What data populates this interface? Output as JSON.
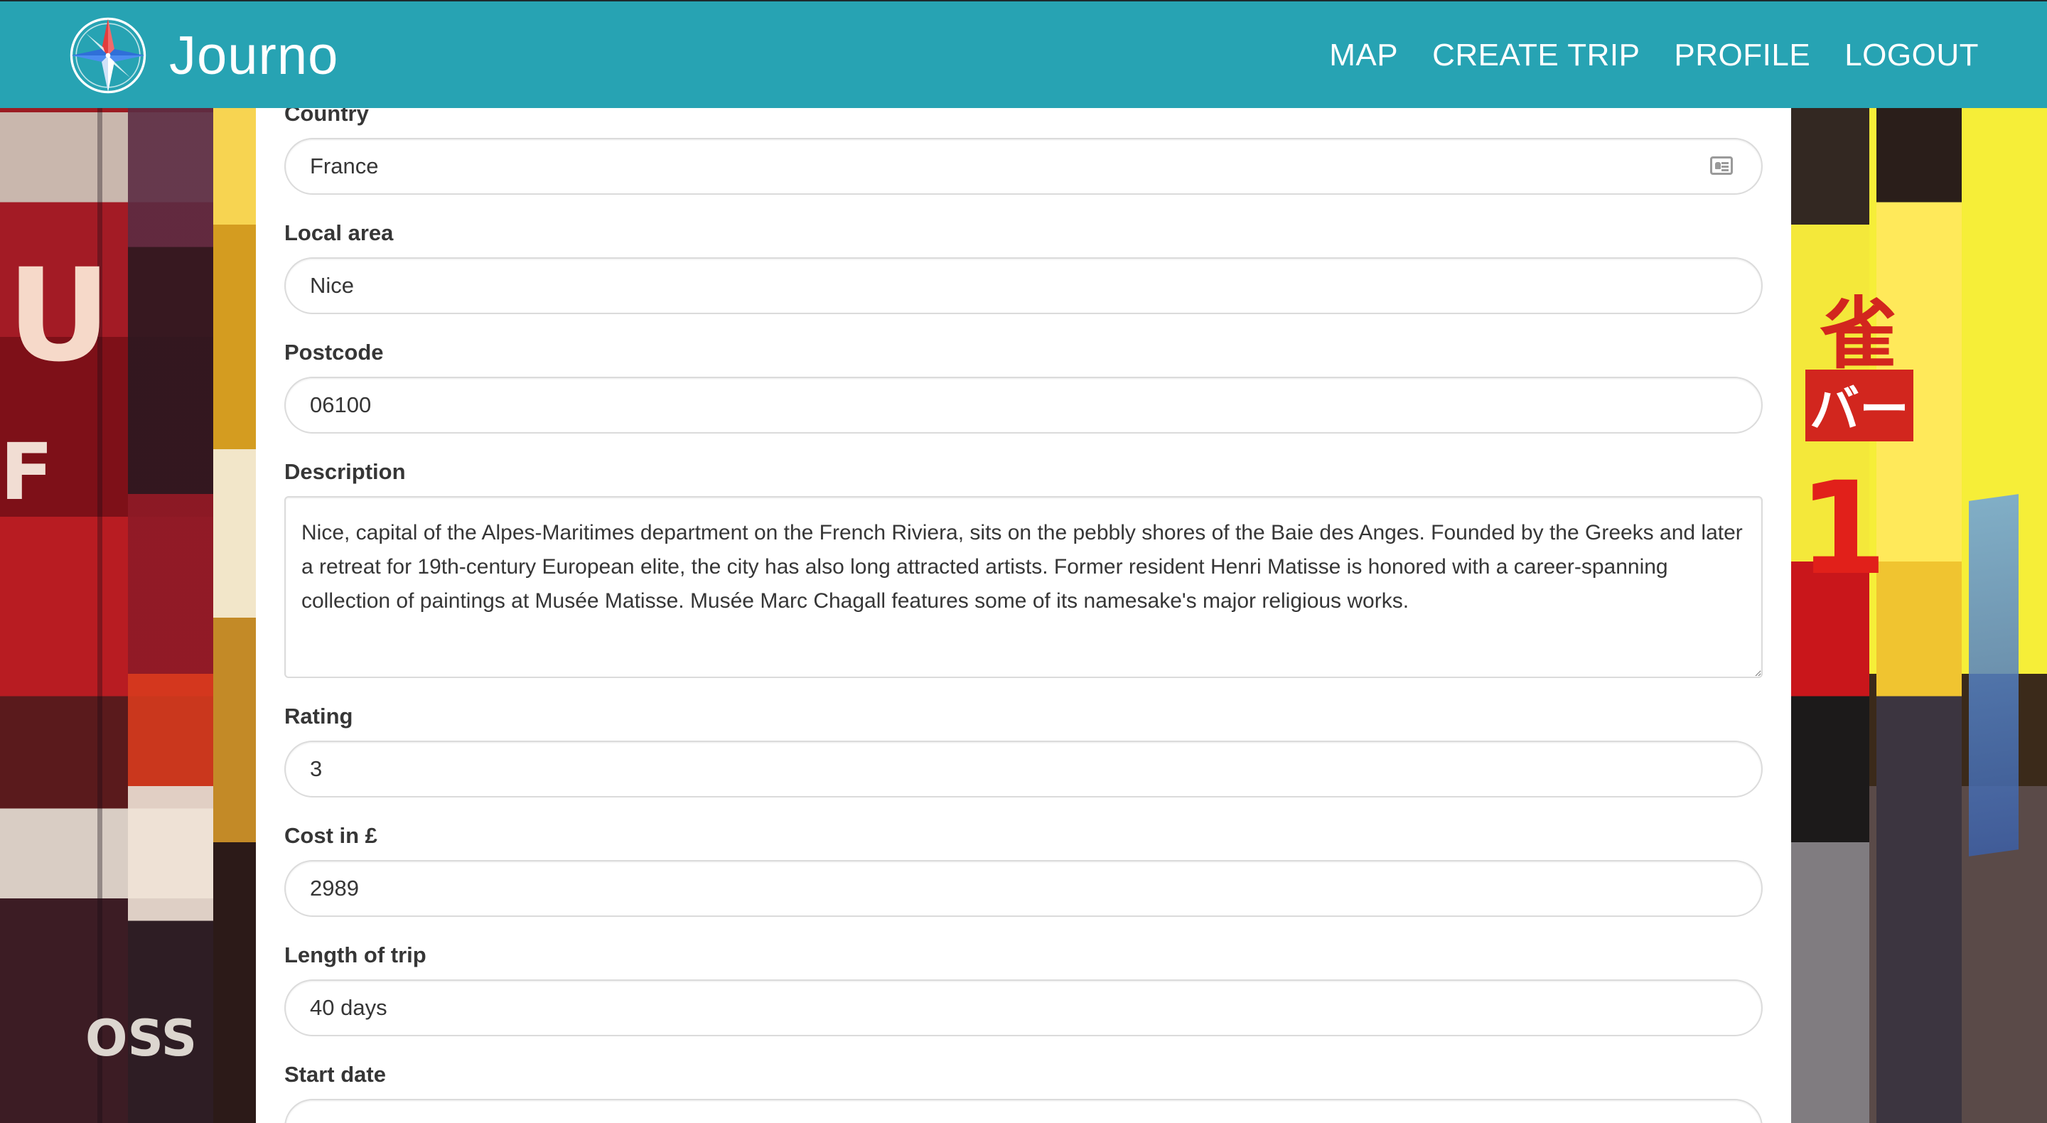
{
  "app": {
    "name": "Journo",
    "logo_icon": "compass-rose-icon"
  },
  "nav": {
    "items": [
      {
        "label": "MAP"
      },
      {
        "label": "CREATE TRIP"
      },
      {
        "label": "PROFILE"
      },
      {
        "label": "LOGOUT"
      }
    ]
  },
  "form": {
    "country": {
      "label": "Country",
      "value": "France",
      "icon": "contact-card-icon"
    },
    "local_area": {
      "label": "Local area",
      "value": "Nice"
    },
    "postcode": {
      "label": "Postcode",
      "value": "06100"
    },
    "description": {
      "label": "Description",
      "value": "Nice, capital of the Alpes-Maritimes department on the French Riviera, sits on the pebbly shores of the Baie des Anges. Founded by the Greeks and later a retreat for 19th-century European elite, the city has also long attracted artists. Former resident Henri Matisse is honored with a career-spanning collection of paintings at Musée Matisse. Musée Marc Chagall features some of its namesake's major religious works."
    },
    "rating": {
      "label": "Rating",
      "value": "3"
    },
    "cost": {
      "label": "Cost in £",
      "value": "2989"
    },
    "length": {
      "label": "Length of trip",
      "value": "40 days"
    },
    "start_date": {
      "label": "Start date",
      "value": ""
    }
  },
  "colors": {
    "navbar": "#27a3b3",
    "nav_text": "#ffffff",
    "label_text": "#363636",
    "input_border": "#dbdbdb"
  }
}
